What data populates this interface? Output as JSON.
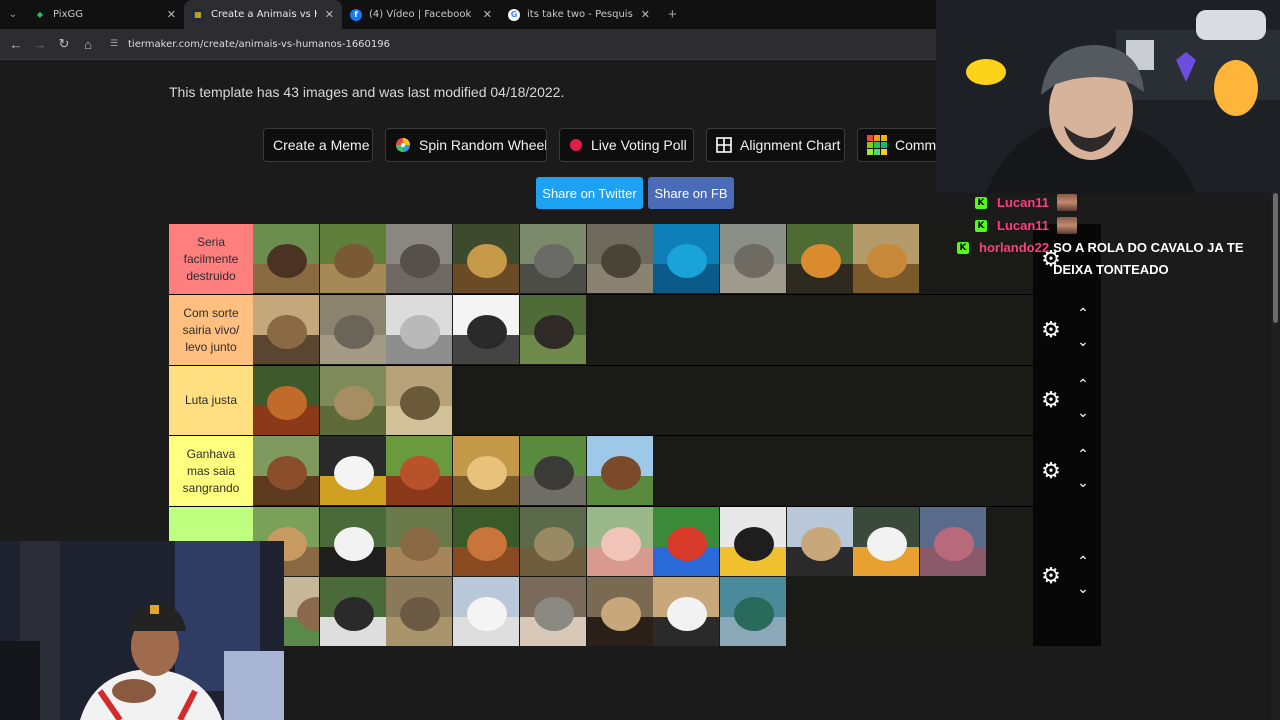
{
  "browser": {
    "tabs": [
      {
        "title": "PixGG",
        "active": false,
        "favicon_color": "#16a34a",
        "favicon_icon": "pixgg-icon"
      },
      {
        "title": "Create a Animais vs Humanos T",
        "active": true,
        "favicon_color": "#374151",
        "favicon_icon": "tiermaker-icon"
      },
      {
        "title": "(4) Vídeo | Facebook",
        "active": false,
        "favicon_color": "#1877f2",
        "favicon_icon": "facebook-icon"
      },
      {
        "title": "its take two - Pesquisa Google",
        "active": false,
        "favicon_color": "#ffffff",
        "favicon_icon": "google-icon"
      }
    ],
    "url": "tiermaker.com/create/animais-vs-humanos-1660196"
  },
  "page": {
    "template_info": "This template has 43 images and was last modified 04/18/2022.",
    "actions": [
      {
        "label": "Create a Meme",
        "icon": "none"
      },
      {
        "label": "Spin Random Wheel",
        "icon": "wheel-icon"
      },
      {
        "label": "Live Voting Poll",
        "icon": "red-dot-icon"
      },
      {
        "label": "Alignment Chart",
        "icon": "grid-icon"
      },
      {
        "label": "Commu",
        "icon": "colorful-grid-icon"
      }
    ],
    "share": {
      "twitter": "Share on Twitter",
      "fb": "Share on FB"
    },
    "colors": {
      "twitter": "#1da1f2",
      "facebook": "#3b5998"
    }
  },
  "tiers": [
    {
      "label": "Seria facilmente destruido",
      "color": "#ff7f7f",
      "items": [
        "bear",
        "moose",
        "hippo",
        "jaguar",
        "elephant",
        "rhino",
        "whale",
        "white rhino",
        "tiger",
        "lion"
      ]
    },
    {
      "label": "Com sorte sairia vivo/ levo junto",
      "color": "#ffbf7f",
      "items": [
        "hyena",
        "crocodile",
        "wolf",
        "chimpanzee",
        "wild boar"
      ]
    },
    {
      "label": "Luta justa",
      "color": "#ffdf7f",
      "items": [
        "orangutan",
        "deer",
        "cobra"
      ]
    },
    {
      "label": "Ganhava mas saia sangrando",
      "color": "#ffff7f",
      "items": [
        "dog",
        "eagle",
        "maned wolf",
        "cheetah",
        "tapir",
        "horse"
      ]
    },
    {
      "label": "",
      "color": "#bfff7f",
      "items": [
        "kangaroo",
        "panda",
        "capybara",
        "monkey",
        "ocelot",
        "pig",
        "macaws",
        "penguin",
        "ostrich",
        "goose",
        "dolphin",
        "deer fawn",
        "vulture",
        "cat",
        "swan",
        "piranha",
        "owl",
        "zebra",
        "peacock"
      ]
    }
  ],
  "chat": [
    {
      "user": "Lucan11",
      "message": ""
    },
    {
      "user": "Lucan11",
      "message": ""
    },
    {
      "user": "horlando22",
      "message": "SO A ROLA DO CAVALO JA TE DEIXA TONTEADO"
    }
  ]
}
